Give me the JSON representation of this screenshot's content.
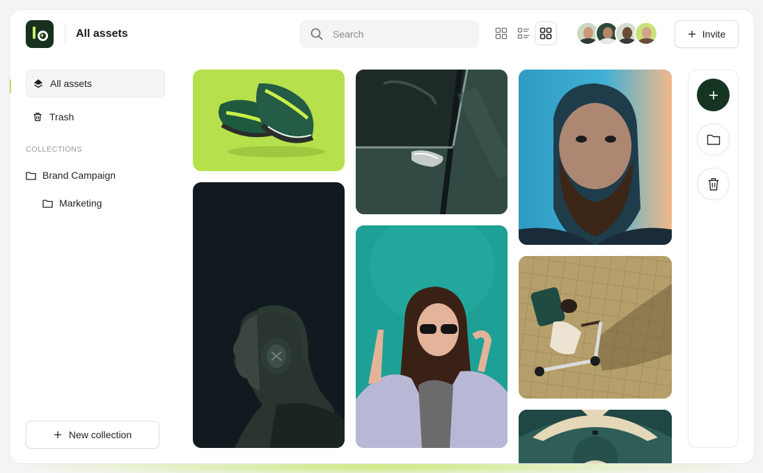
{
  "header": {
    "title": "All assets",
    "search_placeholder": "Search",
    "invite_label": "Invite",
    "views": [
      "grid-small",
      "list",
      "grid-large"
    ],
    "active_view": "grid-large",
    "avatars": [
      "user-1",
      "user-2",
      "user-3",
      "user-4"
    ]
  },
  "sidebar": {
    "items": [
      {
        "label": "All assets",
        "icon": "stack-icon",
        "active": true
      },
      {
        "label": "Trash",
        "icon": "trash-icon",
        "active": false
      }
    ],
    "collections_label": "COLLECTIONS",
    "collections": [
      {
        "label": "Brand Campaign",
        "icon": "folder-icon",
        "level": 0
      },
      {
        "label": "Marketing",
        "icon": "folder-icon",
        "level": 1
      }
    ],
    "new_collection_label": "New collection"
  },
  "assets": [
    {
      "name": "green-sneakers"
    },
    {
      "name": "headphones-portrait"
    },
    {
      "name": "car-door"
    },
    {
      "name": "girl-sunglasses"
    },
    {
      "name": "bearded-man"
    },
    {
      "name": "scooter-delivery"
    },
    {
      "name": "ornamental-pattern"
    }
  ],
  "rail": {
    "buttons": [
      "add",
      "folder",
      "trash"
    ]
  },
  "colors": {
    "brand_dark": "#153522",
    "accent": "#c8f06a"
  }
}
